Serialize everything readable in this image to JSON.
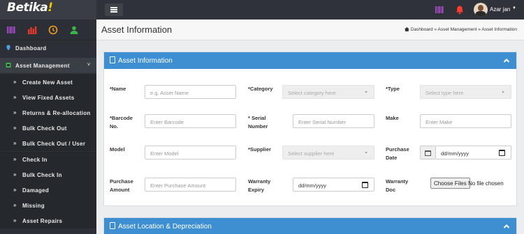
{
  "brand": {
    "name": "Betika",
    "accent": "!"
  },
  "topbar": {
    "user_name": "Azar jan",
    "icons": [
      "barcode-icon",
      "bell-icon",
      "user-avatar"
    ]
  },
  "sidebar": {
    "quick_icons": [
      "barcode-icon",
      "bar-chart-icon",
      "clock-icon",
      "user-icon"
    ],
    "dashboard": "Dashboard",
    "asset_management": "Asset Management",
    "items": [
      "Create New Asset",
      "View Fixed Assets",
      "Returns & Re-allocation",
      "Bulk Check Out",
      "Bulk Check Out / User",
      "Check In",
      "Bulk Check In",
      "Damaged",
      "Missing",
      "Asset Repairs"
    ]
  },
  "page": {
    "title": "Asset Information",
    "breadcrumb": [
      "Dashboard",
      "Asset Management",
      "Asset Information"
    ]
  },
  "panel_info": {
    "title": "Asset Information",
    "fields": {
      "name": {
        "label": "*Name",
        "placeholder": "e.g. Asset Name"
      },
      "category": {
        "label": "*Category",
        "placeholder": "Select category here"
      },
      "type": {
        "label": "*Type",
        "placeholder": "Select type here"
      },
      "barcode": {
        "label_1": "*Barcode",
        "label_2": "No.",
        "placeholder": "Enter Barcode"
      },
      "serial": {
        "label_1": "* Serial",
        "label_2": "Number",
        "placeholder": "Enter Serial Number"
      },
      "make": {
        "label": "Make",
        "placeholder": "Enter Make"
      },
      "model": {
        "label": "Model",
        "placeholder": "Enter Model"
      },
      "supplier": {
        "label": "*Supplier",
        "placeholder": "Select supplier here"
      },
      "purchase_date": {
        "label_1": "Purchase",
        "label_2": "Date",
        "value": "dd/mm/yyyy"
      },
      "purchase_amount": {
        "label_1": "Purchase",
        "label_2": "Amount",
        "placeholder": "Enter Purchase Amount"
      },
      "warranty_expiry": {
        "label_1": "Warranty",
        "label_2": "Expiry",
        "value": "dd/mm/yyyy"
      },
      "warranty_doc": {
        "label_1": "Warranty",
        "label_2": "Doc",
        "button": "Choose Files",
        "note": "No file chosen"
      }
    }
  },
  "panel_location": {
    "title": "Asset Location & Depreciation"
  },
  "colors": {
    "panel_header": "#3d8fd2",
    "sidebar": "#2c2f35",
    "topbar": "#2f3238"
  }
}
